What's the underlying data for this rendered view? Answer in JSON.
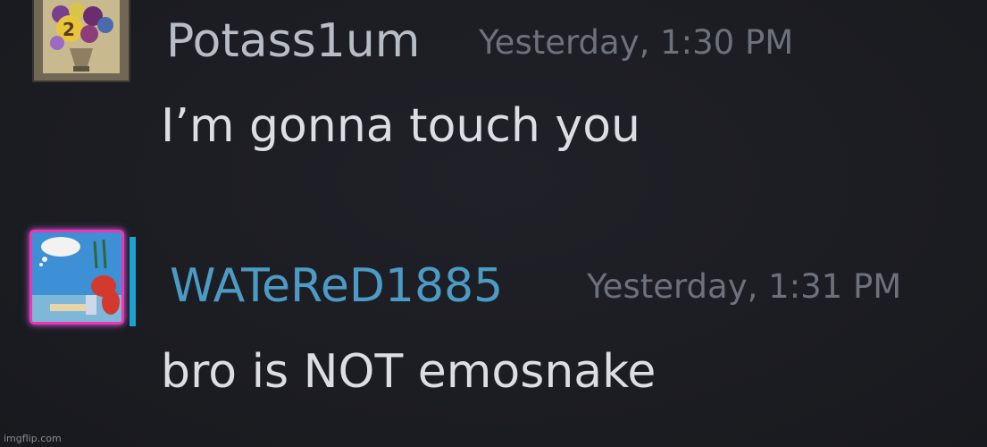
{
  "messages": [
    {
      "username": "Potass1um",
      "timestamp": "Yesterday, 1:30 PM",
      "text": "I’m gonna touch you"
    },
    {
      "username": "WATeReD1885",
      "timestamp": "Yesterday, 1:31 PM",
      "text": "bro is NOT emosnake"
    }
  ],
  "watermark": "imgflip.com",
  "colors": {
    "background": "#1c1d23",
    "username_default": "#b7bcc5",
    "username_highlight": "#4c9bc4",
    "timestamp": "#6c717b",
    "message_text": "#dcdee3",
    "avatar_frame": "#e43ab4",
    "status_bar": "#1aa3cf"
  }
}
